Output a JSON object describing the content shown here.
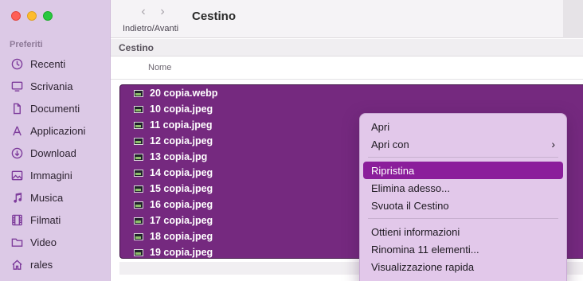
{
  "window": {
    "title": "Cestino"
  },
  "toolbar": {
    "back_glyph": "‹",
    "forward_glyph": "›",
    "nav_label": "Indietro/Avanti"
  },
  "sidebar": {
    "section_title": "Preferiti",
    "items": [
      {
        "label": "Recenti",
        "icon": "clock-icon"
      },
      {
        "label": "Scrivania",
        "icon": "desktop-icon"
      },
      {
        "label": "Documenti",
        "icon": "document-icon"
      },
      {
        "label": "Applicazioni",
        "icon": "applications-icon"
      },
      {
        "label": "Download",
        "icon": "download-icon"
      },
      {
        "label": "Immagini",
        "icon": "photo-icon"
      },
      {
        "label": "Musica",
        "icon": "music-icon"
      },
      {
        "label": "Filmati",
        "icon": "film-icon"
      },
      {
        "label": "Video",
        "icon": "folder-icon"
      },
      {
        "label": "rales",
        "icon": "home-icon"
      }
    ]
  },
  "pathbar": {
    "label": "Cestino"
  },
  "list": {
    "column_name": "Nome",
    "files": [
      "20 copia.webp",
      "10 copia.jpeg",
      "11 copia.jpeg",
      "12 copia.jpeg",
      "13 copia.jpg",
      "14 copia.jpeg",
      "15 copia.jpeg",
      "16 copia.jpeg",
      "17 copia.jpeg",
      "18 copia.jpeg",
      "19 copia.jpeg"
    ]
  },
  "context_menu": {
    "groups": [
      [
        {
          "label": "Apri"
        },
        {
          "label": "Apri con",
          "submenu": true
        }
      ],
      [
        {
          "label": "Ripristina",
          "highlighted": true
        },
        {
          "label": "Elimina adesso..."
        },
        {
          "label": "Svuota il Cestino"
        }
      ],
      [
        {
          "label": "Ottieni informazioni"
        },
        {
          "label": "Rinomina 11 elementi..."
        },
        {
          "label": "Visualizzazione rapida"
        }
      ]
    ]
  },
  "colors": {
    "sidebar_bg": "#dcc9e6",
    "selection": "#75297f",
    "menu_highlight": "#8b1e9b",
    "sidebar_icon": "#7e3c9c"
  }
}
